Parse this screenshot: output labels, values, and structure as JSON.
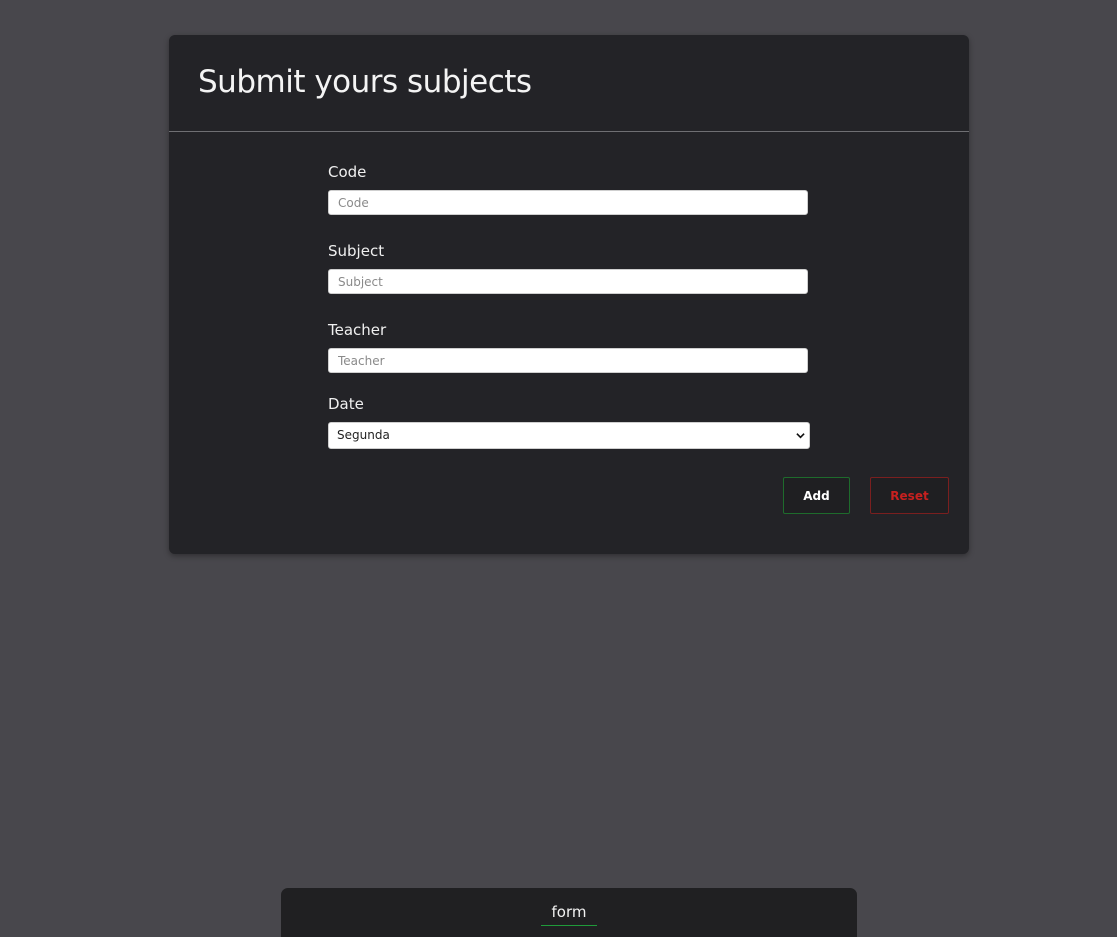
{
  "form_card": {
    "title": "Submit yours subjects"
  },
  "fields": {
    "code": {
      "label": "Code",
      "placeholder": "Code",
      "value": ""
    },
    "subject": {
      "label": "Subject",
      "placeholder": "Subject",
      "value": ""
    },
    "teacher": {
      "label": "Teacher",
      "placeholder": "Teacher",
      "value": ""
    },
    "date": {
      "label": "Date",
      "selected": "Segunda"
    }
  },
  "buttons": {
    "add_label": "Add",
    "reset_label": "Reset"
  },
  "footer": {
    "active_tab": "form"
  },
  "colors": {
    "page_background": "#48474c",
    "card_background": "#232327",
    "add_border": "#1e6b2c",
    "reset_color": "#c8201f",
    "tab_underline": "#1f9a3a"
  },
  "icons": {
    "select_arrow": "chevron-down-icon"
  }
}
